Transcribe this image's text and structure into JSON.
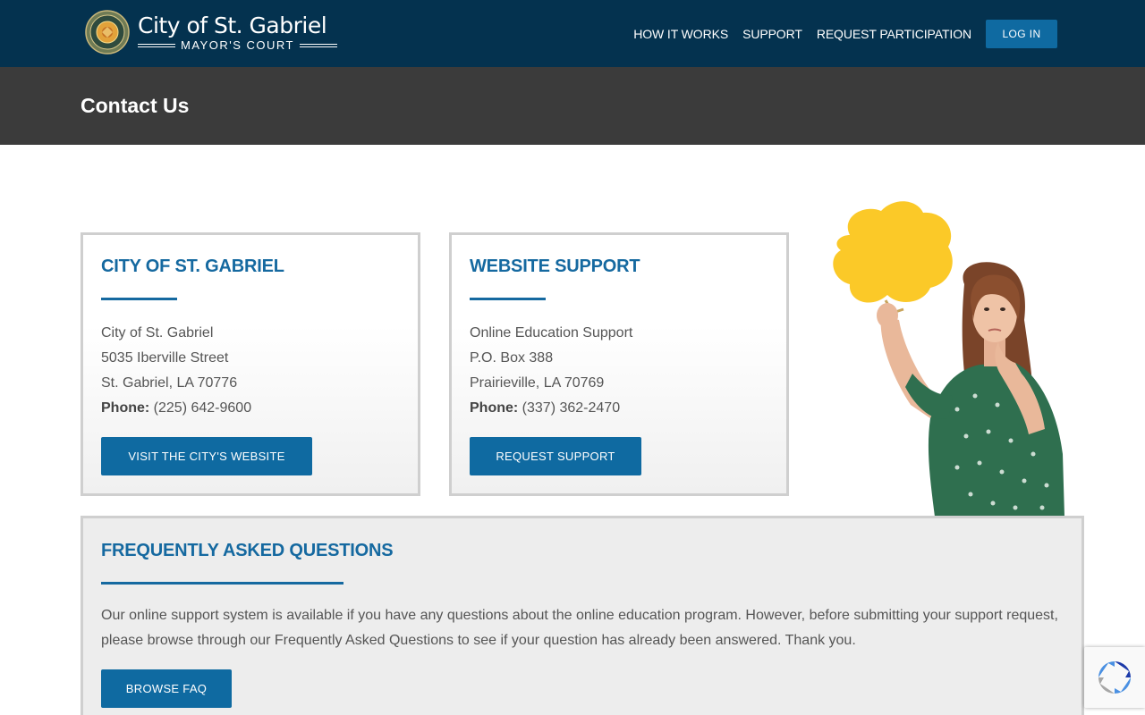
{
  "header": {
    "logo_title": "City of St. Gabriel",
    "logo_subtitle": "MAYOR'S COURT",
    "nav": [
      {
        "label": "HOW IT WORKS"
      },
      {
        "label": "SUPPORT"
      },
      {
        "label": "REQUEST PARTICIPATION"
      }
    ],
    "login_label": "LOG IN"
  },
  "page": {
    "title": "Contact Us"
  },
  "city_card": {
    "heading": "CITY OF ST. GABRIEL",
    "name": "City of St. Gabriel",
    "street": "5035 Iberville Street",
    "city_state": "St. Gabriel, LA 70776",
    "phone_label": "Phone:",
    "phone": "(225) 642-9600",
    "button": "VISIT THE CITY'S WEBSITE"
  },
  "support_card": {
    "heading": "WEBSITE SUPPORT",
    "name": "Online Education Support",
    "street": "P.O. Box 388",
    "city_state": "Prairieville, LA 70769",
    "phone_label": "Phone:",
    "phone": "(337) 362-2470",
    "button": "REQUEST SUPPORT"
  },
  "faq": {
    "heading": "FREQUENTLY ASKED QUESTIONS",
    "text": "Our online support system is available if you have any questions about the online education program. However, before submitting your support request, please browse through our Frequently Asked Questions to see if your question has already been answered. Thank you.",
    "button": "BROWSE FAQ"
  },
  "colors": {
    "header_bg": "#04324f",
    "title_band_bg": "#3b3b3b",
    "accent_blue": "#1569a0",
    "button_blue": "#0f6aa1",
    "speech_bubble": "#fbc928"
  },
  "icons": {
    "logo": "city-seal-icon",
    "recaptcha": "recaptcha-icon"
  }
}
